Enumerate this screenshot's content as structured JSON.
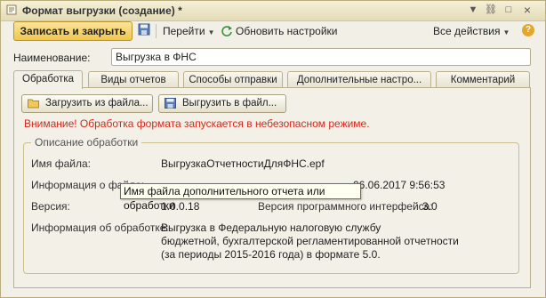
{
  "window": {
    "title": "Формат выгрузки (создание) *",
    "controls": {
      "menu": "▼",
      "link": "⛓",
      "maximize": "□",
      "close": "×"
    }
  },
  "toolbar": {
    "save_close_label": "Записать и закрыть",
    "goto_label": "Перейти",
    "refresh_label": "Обновить настройки",
    "all_actions_label": "Все действия",
    "help_label": "?"
  },
  "form": {
    "name_label": "Наименование:",
    "name_value": "Выгрузка в ФНС"
  },
  "tabs": [
    {
      "label": "Обработка"
    },
    {
      "label": "Виды отчетов"
    },
    {
      "label": "Способы отправки"
    },
    {
      "label": "Дополнительные настро..."
    },
    {
      "label": "Комментарий"
    }
  ],
  "processing": {
    "load_button": "Загрузить из файла...",
    "export_button": "Выгрузить в файл...",
    "warning": "Внимание! Обработка формата запускается в небезопасном режиме.",
    "group_title": "Описание обработки",
    "file_name_label": "Имя файла:",
    "file_name_value": "ВыгрузкаОтчетностиДляФНС.epf",
    "file_info_label": "Информация о файле:",
    "file_info_value": "06.06.2017 9:56:53",
    "version_label": "Версия:",
    "version_value": "1.0.0.18",
    "api_version_label": "Версия программного интерфейса:",
    "api_version_value": "3.0",
    "description_label": "Информация об обработке:",
    "description_lines": [
      "Выгрузка в Федеральную налоговую службу",
      "бюджетной, бухгалтерской регламентированной отчетности",
      "(за периоды 2015-2016 года) в формате 5.0."
    ],
    "tooltip": "Имя файла дополнительного отчета или обработки"
  },
  "colors": {
    "accent": "#f0c64e",
    "warning": "#d6271c",
    "panel": "#f3f1e7"
  }
}
